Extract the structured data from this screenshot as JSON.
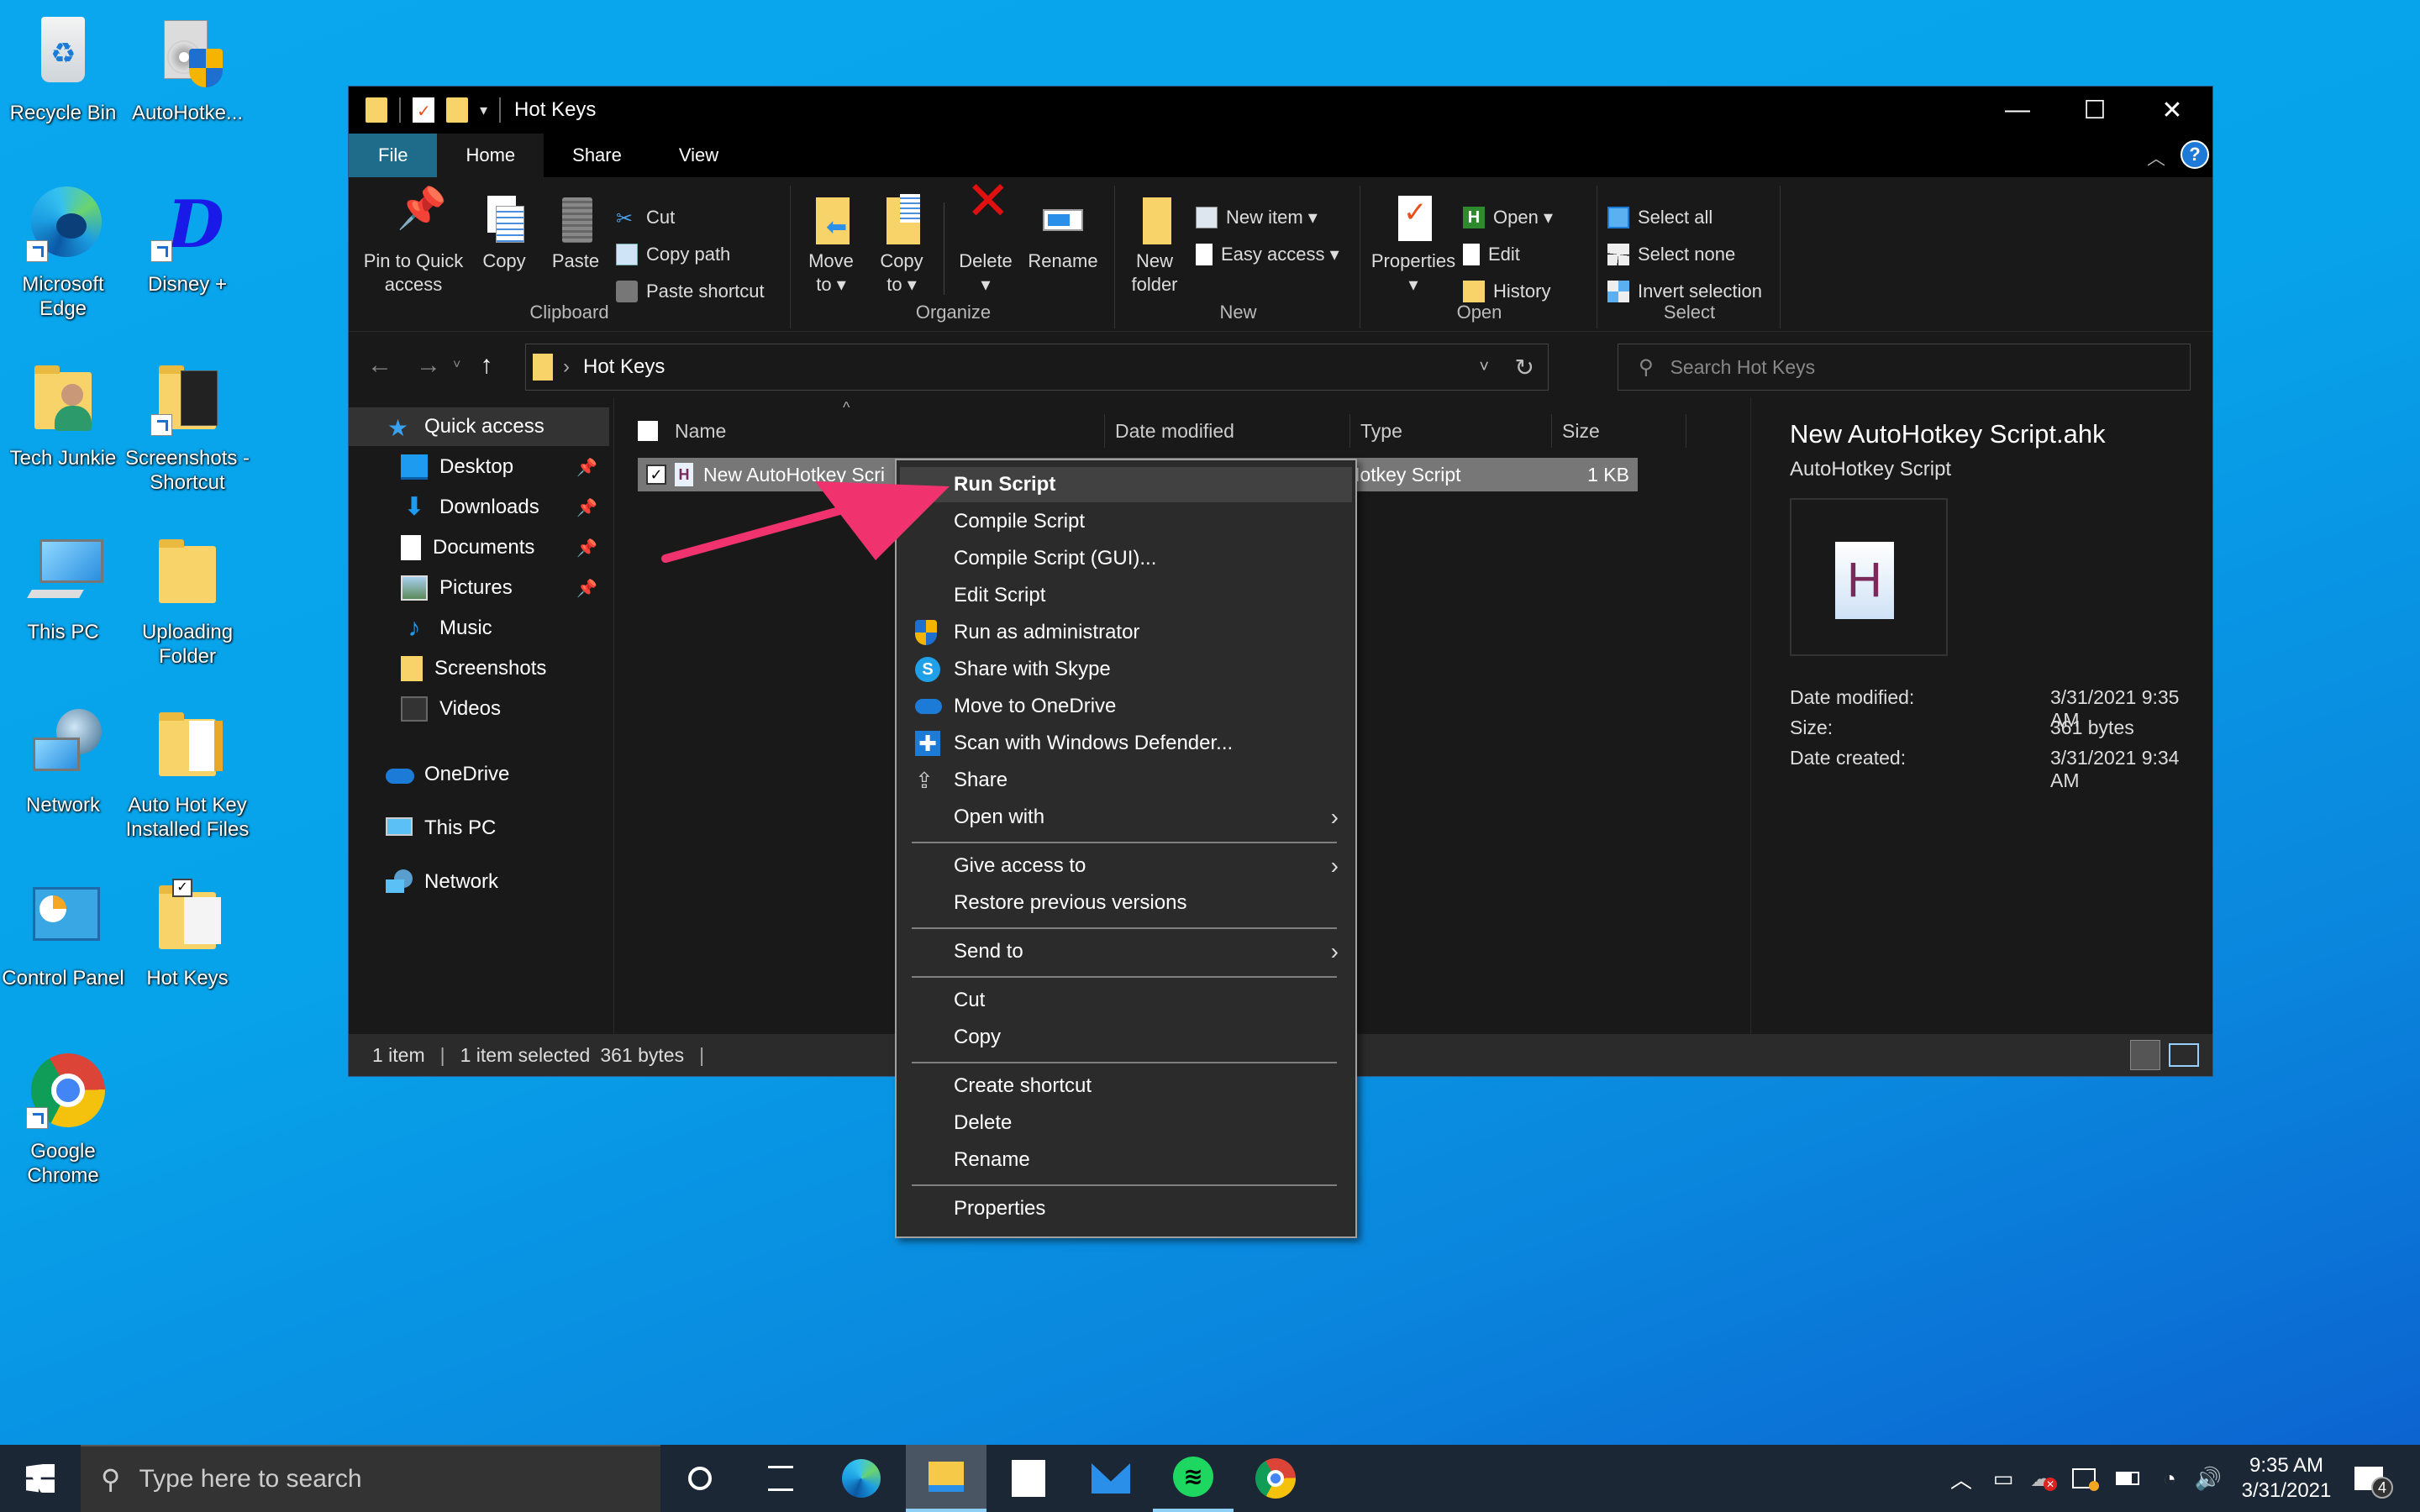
{
  "desktop": {
    "icons": [
      {
        "label": "Recycle Bin",
        "icon": "recycle-bin-icon"
      },
      {
        "label": "AutoHotke...",
        "icon": "autohotkey-installer-icon"
      },
      {
        "label": "Microsoft Edge",
        "icon": "edge-icon"
      },
      {
        "label": "Disney +",
        "icon": "disney-plus-icon"
      },
      {
        "label": "Tech Junkie",
        "icon": "user-folder-icon"
      },
      {
        "label": "Screenshots - Shortcut",
        "icon": "folder-shortcut-icon"
      },
      {
        "label": "This PC",
        "icon": "this-pc-icon"
      },
      {
        "label": "Uploading Folder",
        "icon": "folder-icon"
      },
      {
        "label": "Network",
        "icon": "network-icon"
      },
      {
        "label": "Auto Hot Key Installed Files",
        "icon": "folder-icon"
      },
      {
        "label": "Control Panel",
        "icon": "control-panel-icon"
      },
      {
        "label": "Hot Keys",
        "icon": "folder-icon"
      },
      {
        "label": "Google Chrome",
        "icon": "chrome-icon"
      }
    ]
  },
  "window": {
    "title": "Hot Keys",
    "tabs": [
      "File",
      "Home",
      "Share",
      "View"
    ],
    "ribbon": {
      "clipboard": {
        "label": "Clipboard",
        "pin": "Pin to Quick access",
        "copy": "Copy",
        "paste": "Paste",
        "cut": "Cut",
        "copy_path": "Copy path",
        "paste_shortcut": "Paste shortcut"
      },
      "organize": {
        "label": "Organize",
        "move_to": "Move to",
        "copy_to": "Copy to",
        "delete": "Delete",
        "rename": "Rename"
      },
      "new": {
        "label": "New",
        "new_folder": "New folder",
        "new_item": "New item",
        "easy_access": "Easy access"
      },
      "open": {
        "label": "Open",
        "properties": "Properties",
        "open": "Open",
        "edit": "Edit",
        "history": "History"
      },
      "select": {
        "label": "Select",
        "select_all": "Select all",
        "select_none": "Select none",
        "invert": "Invert selection"
      }
    },
    "address": {
      "path": "Hot Keys"
    },
    "search": {
      "placeholder": "Search Hot Keys"
    },
    "nav": {
      "quick_access": "Quick access",
      "items": [
        {
          "label": "Desktop",
          "pinned": true
        },
        {
          "label": "Downloads",
          "pinned": true
        },
        {
          "label": "Documents",
          "pinned": true
        },
        {
          "label": "Pictures",
          "pinned": true
        },
        {
          "label": "Music",
          "pinned": false
        },
        {
          "label": "Screenshots",
          "pinned": false
        },
        {
          "label": "Videos",
          "pinned": false
        }
      ],
      "onedrive": "OneDrive",
      "this_pc": "This PC",
      "network": "Network"
    },
    "columns": [
      "Name",
      "Date modified",
      "Type",
      "Size"
    ],
    "files": [
      {
        "name": "New AutoHotkey Scri",
        "type": "oHotkey Script",
        "size": "1 KB",
        "selected": true
      }
    ],
    "preview": {
      "filename": "New AutoHotkey Script.ahk",
      "filetype": "AutoHotkey Script",
      "props": [
        {
          "k": "Date modified:",
          "v": "3/31/2021 9:35 AM"
        },
        {
          "k": "Size:",
          "v": "361 bytes"
        },
        {
          "k": "Date created:",
          "v": "3/31/2021 9:34 AM"
        }
      ]
    },
    "status": {
      "count": "1 item",
      "selected": "1 item selected",
      "size": "361 bytes"
    }
  },
  "context_menu": {
    "items": [
      {
        "label": "Run Script",
        "highlighted": true
      },
      {
        "label": "Compile Script"
      },
      {
        "label": "Compile Script (GUI)..."
      },
      {
        "label": "Edit Script"
      },
      {
        "label": "Run as administrator",
        "icon": "uac-shield-icon"
      },
      {
        "label": "Share with Skype",
        "icon": "skype-icon"
      },
      {
        "label": "Move to OneDrive",
        "icon": "onedrive-icon"
      },
      {
        "label": "Scan with Windows Defender...",
        "icon": "defender-icon"
      },
      {
        "label": "Share",
        "icon": "share-icon"
      },
      {
        "label": "Open with",
        "submenu": true
      },
      {
        "label": "Give access to",
        "submenu": true
      },
      {
        "label": "Restore previous versions"
      },
      {
        "label": "Send to",
        "submenu": true
      },
      {
        "label": "Cut"
      },
      {
        "label": "Copy"
      },
      {
        "label": "Create shortcut"
      },
      {
        "label": "Delete"
      },
      {
        "label": "Rename"
      },
      {
        "label": "Properties"
      }
    ]
  },
  "annotation": {
    "color": "#f0326e"
  },
  "taskbar": {
    "search_placeholder": "Type here to search",
    "apps": [
      "cortana",
      "task-view",
      "edge",
      "file-explorer",
      "store",
      "mail",
      "spotify",
      "chrome"
    ],
    "time": "9:35 AM",
    "date": "3/31/2021",
    "notifications": "4"
  }
}
